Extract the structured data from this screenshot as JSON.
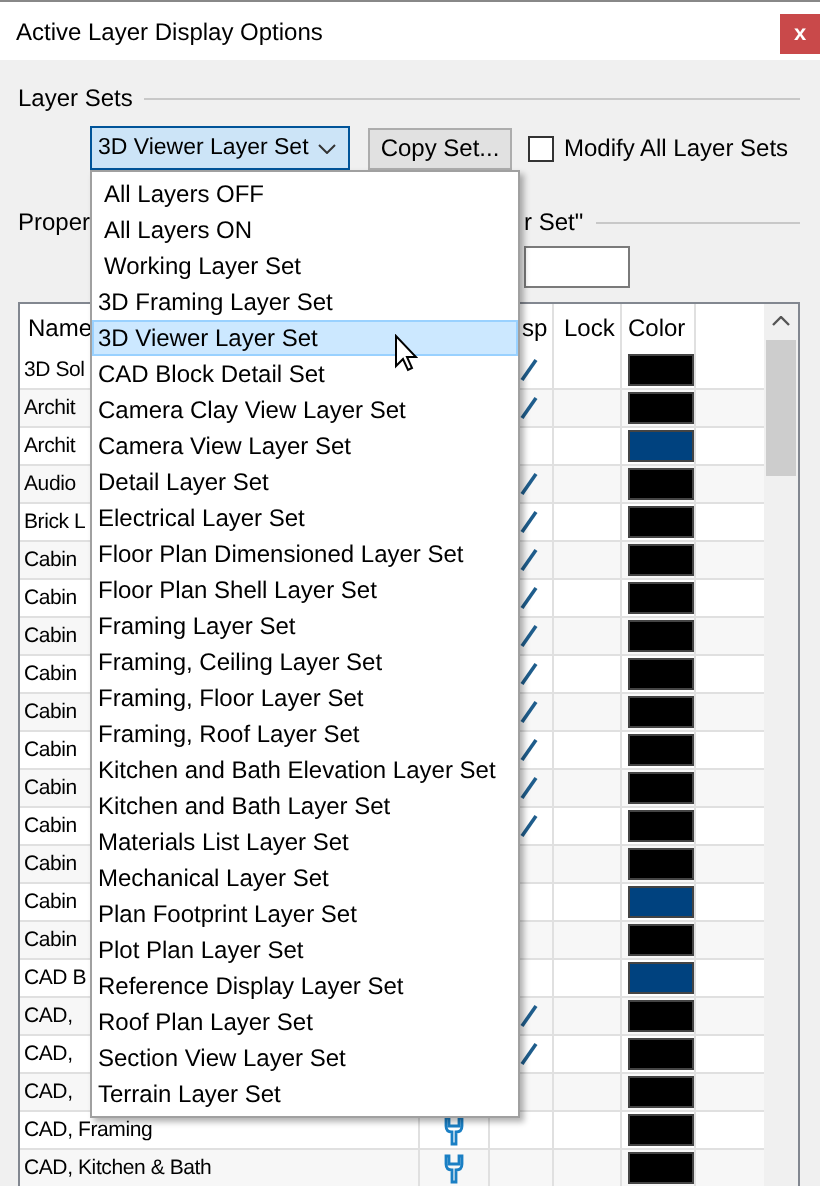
{
  "window": {
    "title": "Active Layer Display Options",
    "close": "x"
  },
  "layer_sets": {
    "label": "Layer Sets",
    "dropdown": {
      "value": "3D Viewer Layer Set",
      "expanded": true
    },
    "copy_button": "Copy Set...",
    "modify_all": {
      "label": "Modify All Layer Sets",
      "checked": false
    }
  },
  "properties": {
    "label_left": "Proper",
    "label_right": "r Set\""
  },
  "dropdown_list": [
    {
      "label": "All Layers OFF",
      "kind": "builtin",
      "selected": false
    },
    {
      "label": "All Layers ON",
      "kind": "builtin",
      "selected": false
    },
    {
      "label": "Working Layer Set",
      "kind": "builtin",
      "selected": false
    },
    {
      "label": "3D Framing Layer Set",
      "kind": "set",
      "selected": false
    },
    {
      "label": "3D Viewer Layer Set",
      "kind": "set",
      "selected": true
    },
    {
      "label": "CAD Block Detail Set",
      "kind": "set",
      "selected": false
    },
    {
      "label": "Camera Clay View Layer Set",
      "kind": "set",
      "selected": false
    },
    {
      "label": "Camera View Layer Set",
      "kind": "set",
      "selected": false
    },
    {
      "label": "Detail Layer Set",
      "kind": "set",
      "selected": false
    },
    {
      "label": "Electrical Layer Set",
      "kind": "set",
      "selected": false
    },
    {
      "label": "Floor Plan Dimensioned Layer Set",
      "kind": "set",
      "selected": false
    },
    {
      "label": "Floor Plan Shell Layer Set",
      "kind": "set",
      "selected": false
    },
    {
      "label": "Framing Layer Set",
      "kind": "set",
      "selected": false
    },
    {
      "label": "Framing, Ceiling Layer Set",
      "kind": "set",
      "selected": false
    },
    {
      "label": "Framing, Floor Layer Set",
      "kind": "set",
      "selected": false
    },
    {
      "label": "Framing, Roof Layer Set",
      "kind": "set",
      "selected": false
    },
    {
      "label": "Kitchen and Bath Elevation Layer Set",
      "kind": "set",
      "selected": false
    },
    {
      "label": "Kitchen and Bath Layer Set",
      "kind": "set",
      "selected": false
    },
    {
      "label": "Materials List Layer Set",
      "kind": "set",
      "selected": false
    },
    {
      "label": "Mechanical Layer Set",
      "kind": "set",
      "selected": false
    },
    {
      "label": "Plan Footprint Layer Set",
      "kind": "set",
      "selected": false
    },
    {
      "label": "Plot Plan Layer Set",
      "kind": "set",
      "selected": false
    },
    {
      "label": "Reference Display Layer Set",
      "kind": "set",
      "selected": false
    },
    {
      "label": "Roof Plan Layer Set",
      "kind": "set",
      "selected": false
    },
    {
      "label": "Section View Layer Set",
      "kind": "set",
      "selected": false
    },
    {
      "label": "Terrain Layer Set",
      "kind": "set",
      "selected": false
    }
  ],
  "table": {
    "columns": [
      "Name",
      "sp",
      "Lock",
      "Color"
    ],
    "rows": [
      {
        "name": "3D Sol",
        "disp": true,
        "color": "#000000"
      },
      {
        "name": "Archit",
        "disp": true,
        "color": "#000000"
      },
      {
        "name": "Archit",
        "disp": false,
        "color": "#00427f"
      },
      {
        "name": "Audio",
        "disp": true,
        "color": "#000000"
      },
      {
        "name": "Brick L",
        "disp": true,
        "color": "#000000"
      },
      {
        "name": "Cabin",
        "disp": true,
        "color": "#000000"
      },
      {
        "name": "Cabin",
        "disp": true,
        "color": "#000000"
      },
      {
        "name": "Cabin",
        "disp": true,
        "color": "#000000"
      },
      {
        "name": "Cabin",
        "disp": true,
        "color": "#000000"
      },
      {
        "name": "Cabin",
        "disp": true,
        "color": "#000000"
      },
      {
        "name": "Cabin",
        "disp": true,
        "color": "#000000"
      },
      {
        "name": "Cabin",
        "disp": true,
        "color": "#000000"
      },
      {
        "name": "Cabin",
        "disp": true,
        "color": "#000000"
      },
      {
        "name": "Cabin",
        "disp": false,
        "color": "#000000"
      },
      {
        "name": "Cabin",
        "disp": false,
        "color": "#00427f"
      },
      {
        "name": "Cabin",
        "disp": false,
        "color": "#000000"
      },
      {
        "name": "CAD B",
        "disp": false,
        "color": "#00427f"
      },
      {
        "name": "CAD,",
        "disp": true,
        "color": "#000000"
      },
      {
        "name": "CAD,",
        "disp": true,
        "color": "#000000"
      },
      {
        "name": "CAD,",
        "disp": false,
        "color": "#000000"
      },
      {
        "name": "CAD, Framing",
        "disp": false,
        "wrench": true,
        "color": "#000000"
      },
      {
        "name": "CAD, Kitchen & Bath",
        "wrench": true,
        "disp": false,
        "color": "#000000"
      }
    ]
  }
}
